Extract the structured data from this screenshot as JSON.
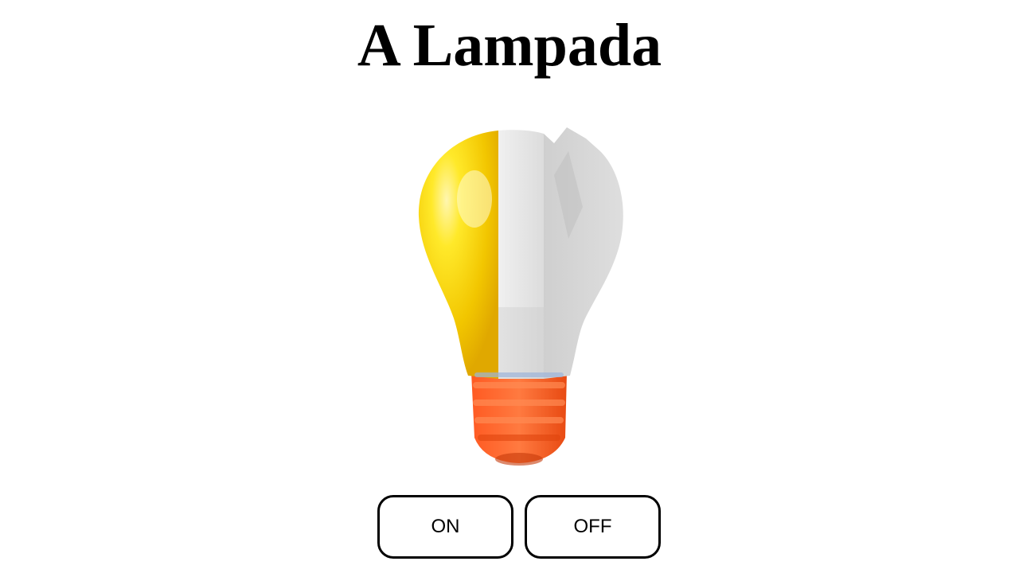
{
  "page": {
    "title": "A Lampada"
  },
  "bulb": {
    "icon": "lightbulb-icon",
    "state": "half-on-half-broken",
    "colors": {
      "lit_glass": "#f4cf00",
      "off_glass": "#e6e6e6",
      "broken_glass": "#d2d2d2",
      "base": "#ff6a2b"
    }
  },
  "controls": {
    "on_label": "ON",
    "off_label": "OFF"
  }
}
